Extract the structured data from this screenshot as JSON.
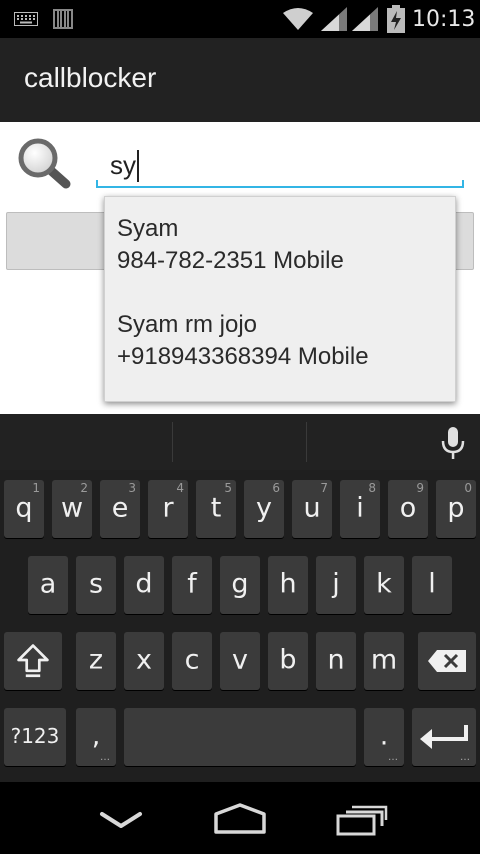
{
  "status_bar": {
    "time": "10:13",
    "icons": [
      "keyboard-icon",
      "barcode-icon",
      "wifi-icon",
      "signal-icon",
      "signal-icon",
      "battery-charging-icon"
    ]
  },
  "action_bar": {
    "title": "callblocker"
  },
  "search": {
    "value": "sy",
    "icon": "search-icon",
    "accent_color": "#33b5e5"
  },
  "suggestions": [
    {
      "name": "Syam",
      "number": "984-782-2351 Mobile"
    },
    {
      "name": "Syam rm jojo",
      "number": "+918943368394 Mobile"
    }
  ],
  "keyboard": {
    "row1": [
      {
        "label": "q",
        "hint": "1"
      },
      {
        "label": "w",
        "hint": "2"
      },
      {
        "label": "e",
        "hint": "3"
      },
      {
        "label": "r",
        "hint": "4"
      },
      {
        "label": "t",
        "hint": "5"
      },
      {
        "label": "y",
        "hint": "6"
      },
      {
        "label": "u",
        "hint": "7"
      },
      {
        "label": "i",
        "hint": "8"
      },
      {
        "label": "o",
        "hint": "9"
      },
      {
        "label": "p",
        "hint": "0"
      }
    ],
    "row2": [
      "a",
      "s",
      "d",
      "f",
      "g",
      "h",
      "j",
      "k",
      "l"
    ],
    "row3": [
      "z",
      "x",
      "c",
      "v",
      "b",
      "n",
      "m"
    ],
    "symbols_label": "?123",
    "comma_label": ",",
    "period_label": ".",
    "shift_icon": "shift-icon",
    "delete_icon": "backspace-icon",
    "enter_icon": "enter-icon",
    "mic_icon": "mic-icon"
  },
  "nav_bar": {
    "icons": [
      "back-icon",
      "home-icon",
      "recents-icon"
    ]
  }
}
